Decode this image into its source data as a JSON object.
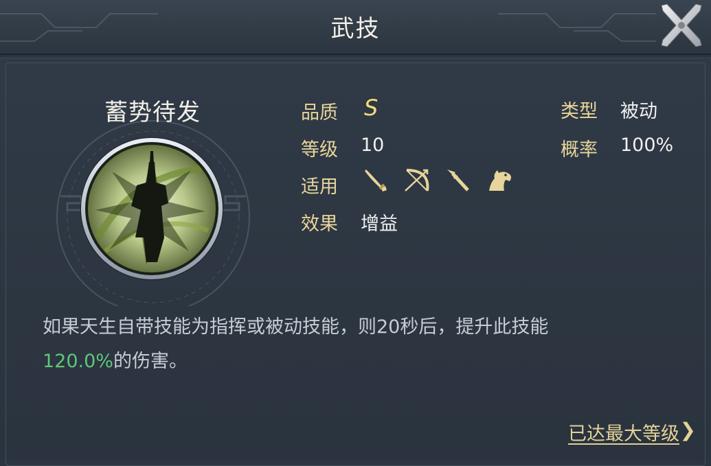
{
  "header": {
    "title": "武技"
  },
  "icons": {
    "close": "close-x-icon",
    "skill": "skill-emblem-icon"
  },
  "skill": {
    "name": "蓄势待发"
  },
  "attributes": {
    "quality_label": "品质",
    "quality_value": "S",
    "level_label": "等级",
    "level_value": "10",
    "applies_label": "适用",
    "effect_label": "效果",
    "effect_value": "增益",
    "type_label": "类型",
    "type_value": "被动",
    "chance_label": "概率",
    "chance_value": "100%"
  },
  "weapons": [
    "sword-icon",
    "bow-icon",
    "spear-icon",
    "horse-icon"
  ],
  "description": {
    "part1": "如果天生自带技能为指挥或被动技能，则20秒后，提升此技能",
    "highlight": "120.0%",
    "part2": "的伤害。"
  },
  "footer": {
    "max_level_label": "已达最大等级",
    "arrow": "❯"
  },
  "colors": {
    "label": "#e8d59b",
    "highlight": "#5ec77a",
    "gold": "#e3d198"
  }
}
